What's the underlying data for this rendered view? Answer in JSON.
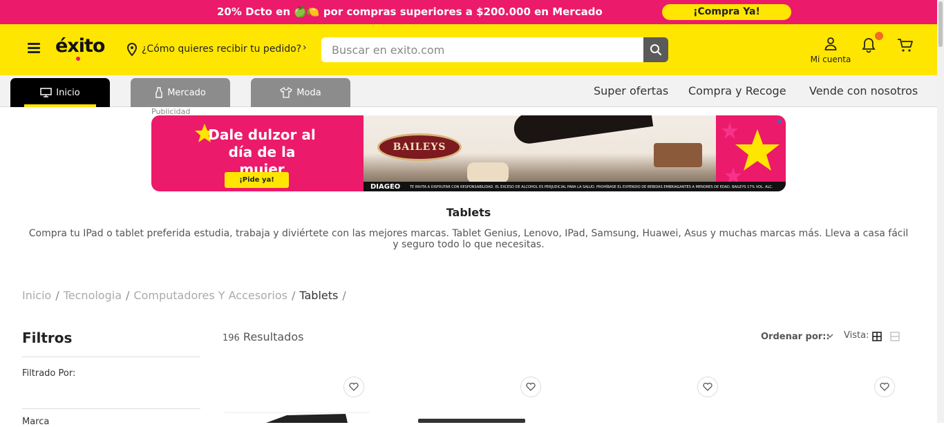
{
  "promo": {
    "text": "20% Dcto en 🍏🍋 por compras superiores a $200.000 en Mercado",
    "cta": "¡Compra Ya!"
  },
  "header": {
    "logo": "éxito",
    "delivery_prompt": "¿Cómo quieres recibir tu pedido?",
    "search_placeholder": "Buscar en exito.com",
    "account_label": "Mi cuenta"
  },
  "nav": {
    "tabs": [
      {
        "label": "Inicio",
        "icon": "monitor-icon"
      },
      {
        "label": "Mercado",
        "icon": "bottle-icon"
      },
      {
        "label": "Moda",
        "icon": "shirt-icon"
      }
    ],
    "links": [
      "Super ofertas",
      "Compra y Recoge",
      "Vende con nosotros"
    ]
  },
  "ad": {
    "label": "Publicidad",
    "headline_1": "Dale dulzor al",
    "headline_2": "día de la mujer",
    "cta": "¡Pide ya!",
    "brand": "BAILEYS",
    "sponsor": "DIAGEO",
    "legal": "TE INVITA A DISFRUTAR CON RESPONSABILIDAD. EL EXCESO DE ALCOHOL ES PERJUDICIAL PARA LA SALUD. PROHÍBASE EL EXPENDIO DE BEBIDAS EMBRIAGANTES A MENORES DE EDAD. BAILEYS 17% VOL. ALC.",
    "close": "✕"
  },
  "category": {
    "title": "Tablets",
    "description": "Compra tu IPad o tablet preferida estudia, trabaja y diviértete con las mejores marcas. Tablet Genius, Lenovo, IPad, Samsung, Huawei, Asus y muchas marcas más. Lleva a casa fácil y seguro todo lo que necesitas."
  },
  "breadcrumb": {
    "items": [
      "Inicio",
      "Tecnologia",
      "Computadores Y Accesorios"
    ],
    "current": "Tablets",
    "separator": "/"
  },
  "filters": {
    "title": "Filtros",
    "filtered_by": "Filtrado Por:",
    "brand": "Marca"
  },
  "results": {
    "count": "196",
    "label": "Resultados",
    "sort_label": "Ordenar por::",
    "view_label": "Vista:"
  },
  "colors": {
    "brand_yellow": "#ffe600",
    "promo_pink": "#ec1a6a",
    "active_tab": "#000000",
    "inactive_tab": "#8c8c8c"
  }
}
